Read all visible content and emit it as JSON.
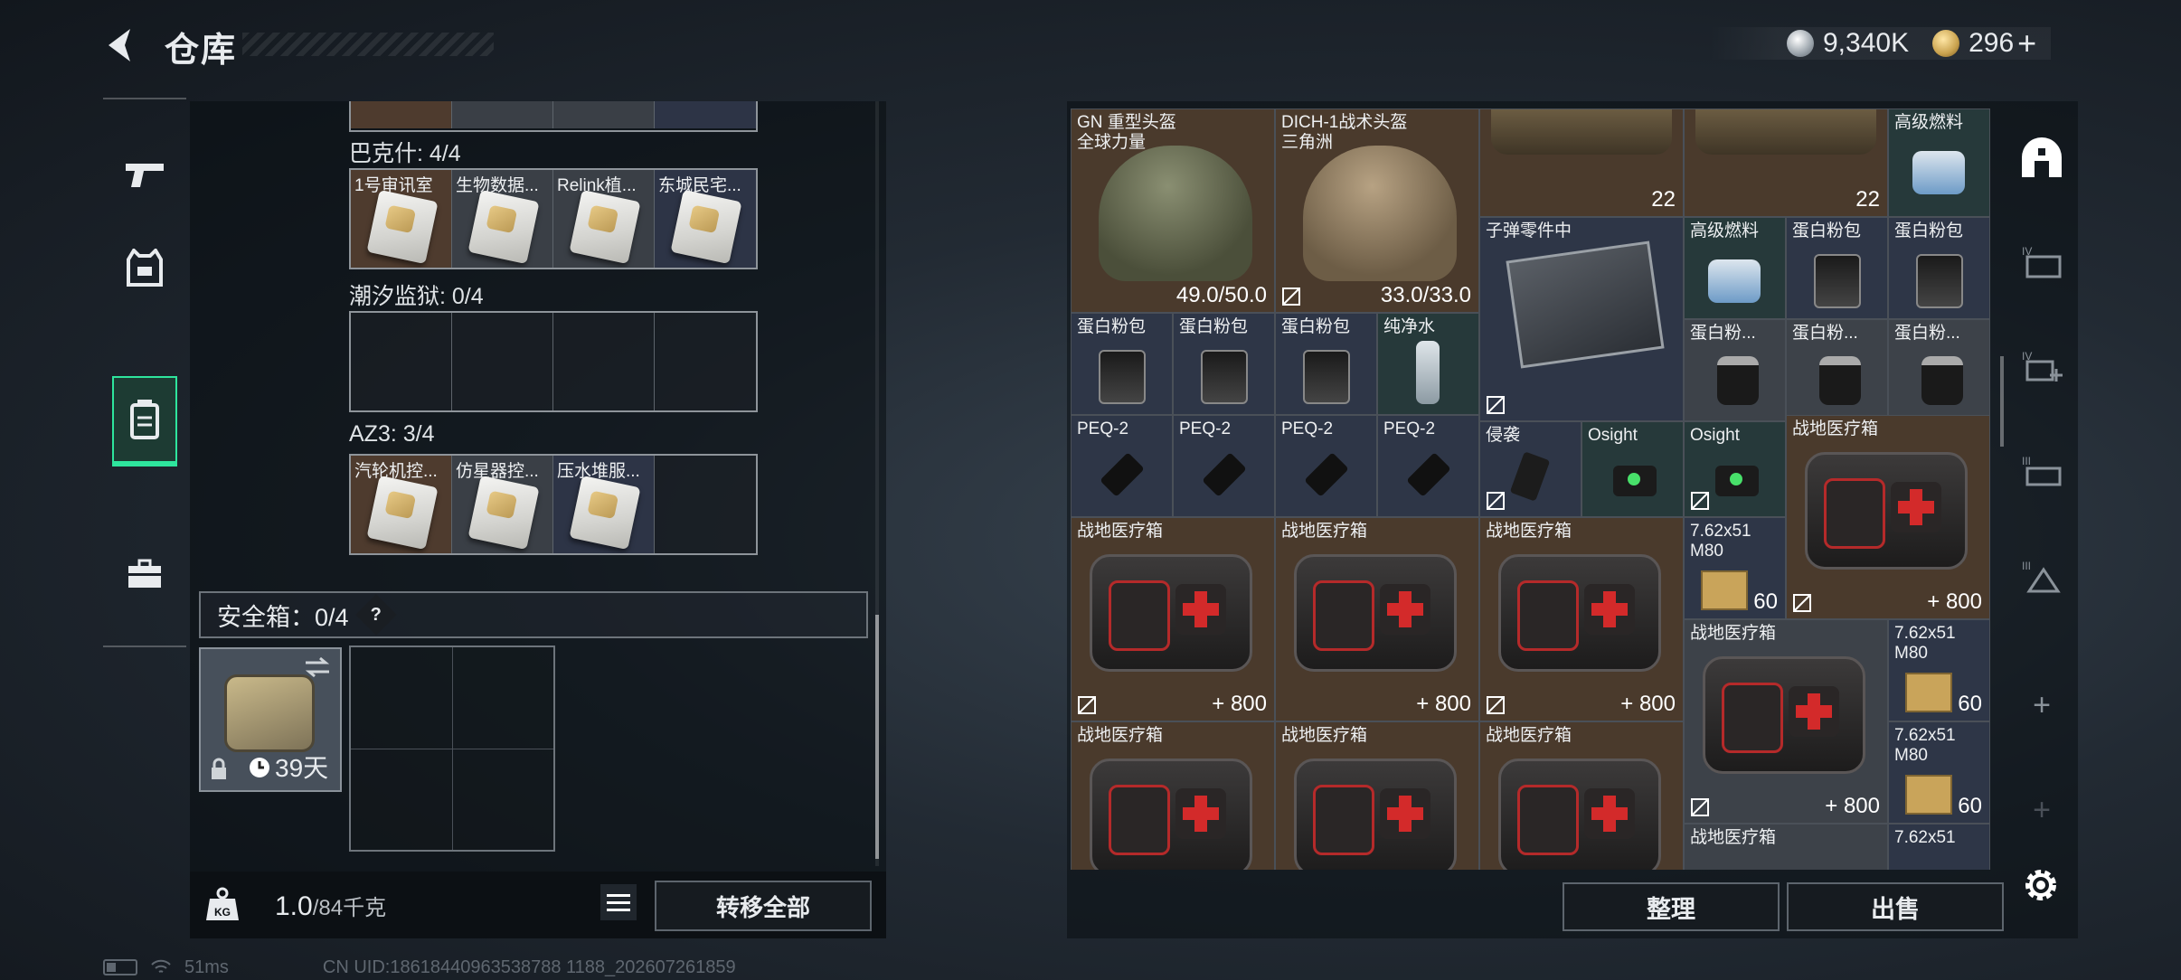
{
  "header": {
    "title": "仓库"
  },
  "currency": {
    "silver": "9,340K",
    "gold": "296",
    "plus": "+"
  },
  "left": {
    "sections": [
      {
        "title": "巴克什: 4/4",
        "items": [
          {
            "label": "1号审讯室",
            "color": "orange"
          },
          {
            "label": "生物数据...",
            "color": "grey"
          },
          {
            "label": "Relink植...",
            "color": "grey"
          },
          {
            "label": "东城民宅...",
            "color": "blue"
          }
        ]
      },
      {
        "title": "潮汐监狱: 0/4",
        "items": []
      },
      {
        "title": "AZ3: 3/4",
        "items": [
          {
            "label": "汽轮机控...",
            "color": "orange"
          },
          {
            "label": "仿星器控...",
            "color": "grey"
          },
          {
            "label": "压水堆服...",
            "color": "blue"
          }
        ]
      }
    ],
    "safebox": {
      "title": "安全箱：0/4",
      "help": "?",
      "days": "39天"
    },
    "weight": {
      "current": "1.0",
      "max": "/84千克"
    },
    "transfer_all": "转移全部"
  },
  "stash": {
    "items": [
      {
        "name": "GN 重型头盔",
        "sub": "全球力量",
        "qty": "49.0/50.0"
      },
      {
        "name": "DICH-1战术头盔",
        "sub": "三角洲",
        "qty": "33.0/33.0"
      },
      {
        "name": "",
        "qty": "22"
      },
      {
        "name": "",
        "qty": "22"
      },
      {
        "name": "高级燃料",
        "qty": ""
      },
      {
        "name": "子弹零件中",
        "qty": ""
      },
      {
        "name": "高级燃料",
        "qty": ""
      },
      {
        "name": "蛋白粉包",
        "qty": ""
      },
      {
        "name": "蛋白粉包",
        "qty": ""
      },
      {
        "name": "蛋白粉包",
        "qty": ""
      },
      {
        "name": "蛋白粉包",
        "qty": ""
      },
      {
        "name": "蛋白粉包",
        "qty": ""
      },
      {
        "name": "纯净水",
        "qty": ""
      },
      {
        "name": "蛋白粉...",
        "qty": ""
      },
      {
        "name": "蛋白粉...",
        "qty": ""
      },
      {
        "name": "蛋白粉...",
        "qty": ""
      },
      {
        "name": "PEQ-2",
        "qty": ""
      },
      {
        "name": "PEQ-2",
        "qty": ""
      },
      {
        "name": "PEQ-2",
        "qty": ""
      },
      {
        "name": "PEQ-2",
        "qty": ""
      },
      {
        "name": "侵袭",
        "qty": ""
      },
      {
        "name": "Osight",
        "qty": ""
      },
      {
        "name": "Osight",
        "qty": ""
      },
      {
        "name": "战地医疗箱",
        "qty": "+ 800"
      },
      {
        "name": "战地医疗箱",
        "qty": "+ 800"
      },
      {
        "name": "战地医疗箱",
        "qty": "+ 800"
      },
      {
        "name": "战地医疗箱",
        "qty": "+ 800"
      },
      {
        "name": "7.62x51 M80",
        "qty": "60"
      },
      {
        "name": "战地医疗箱",
        "qty": "+ 800"
      },
      {
        "name": "7.62x51 M80",
        "qty": "60"
      },
      {
        "name": "战地医疗箱",
        "qty": ""
      },
      {
        "name": "战地医疗箱",
        "qty": ""
      },
      {
        "name": "战地医疗箱",
        "qty": ""
      },
      {
        "name": "7.62x51 M80",
        "qty": "60"
      },
      {
        "name": "战地医疗箱",
        "qty": ""
      },
      {
        "name": "7.62x51",
        "qty": ""
      }
    ],
    "sort": "整理",
    "sell": "出售"
  },
  "status": {
    "latency": "51ms",
    "uid": "CN UID:18618440963538788 1188_202607261859"
  }
}
